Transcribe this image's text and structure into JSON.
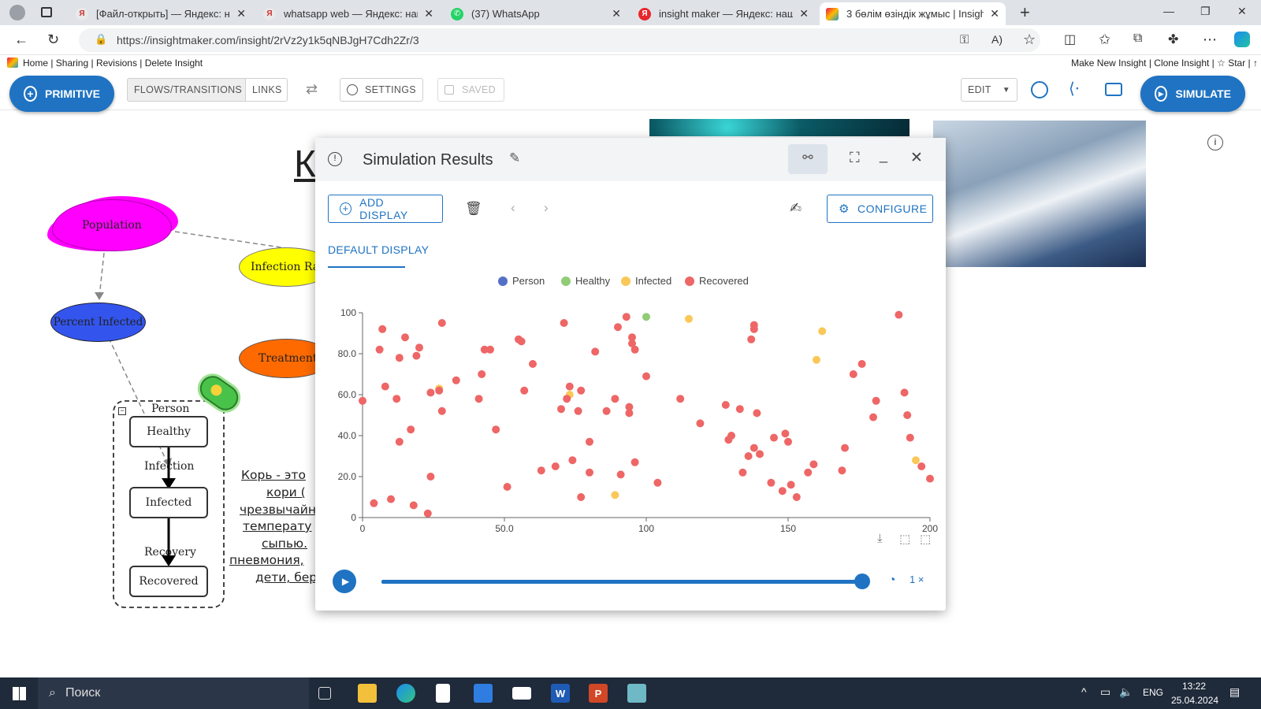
{
  "browser": {
    "tabs": [
      {
        "label": "[Файл-открыть] — Яндекс: нашл",
        "icon": "yandex-icon",
        "active": false
      },
      {
        "label": "whatsapp web — Яндекс: нашлс",
        "icon": "yandex-icon",
        "active": false
      },
      {
        "label": "(37) WhatsApp",
        "icon": "whatsapp-icon",
        "active": false
      },
      {
        "label": "insight maker — Яндекс: нашлос",
        "icon": "yandex-red-icon",
        "active": false
      },
      {
        "label": "3 бөлім өзіндік жұмыс | Insight",
        "icon": "insightmaker-icon",
        "active": true
      }
    ],
    "url": "https://insightmaker.com/insight/2rVz2y1k5qNBJgH7Cdh2Zr/3"
  },
  "insight_links": {
    "left": "Home | Sharing | Revisions | Delete Insight",
    "right": "Make New Insight | Clone Insight | ☆ Star | ↑"
  },
  "toolbar": {
    "primitive": "PRIMITIVE",
    "flows": "FLOWS/TRANSITIONS",
    "links": "LINKS",
    "settings": "SETTINGS",
    "saved": "SAVED",
    "edit": "EDIT",
    "simulate": "SIMULATE"
  },
  "diagram": {
    "title_fragment": "К",
    "population": "Population",
    "infection_rate": "Infection Ra",
    "percent_infected": "Percent Infected",
    "treatment": "Treatment",
    "agent_label": "Person",
    "states": [
      "Healthy",
      "Infected",
      "Recovered"
    ],
    "transitions": [
      "Infection",
      "Recovery"
    ],
    "description_lines": [
      "Корь - это",
      "кори (",
      "чрезвычайн",
      "температу",
      "сыпью.",
      "пневмония,",
      "дети, бер"
    ]
  },
  "sim": {
    "title": "Simulation Results",
    "add_display": "ADD DISPLAY",
    "configure": "CONFIGURE",
    "tab": "DEFAULT DISPLAY",
    "speed": "1 ×"
  },
  "chart_data": {
    "type": "scatter",
    "legend": [
      "Person",
      "Healthy",
      "Infected",
      "Recovered"
    ],
    "colors": {
      "Person": "#5470c6",
      "Healthy": "#91cc75",
      "Infected": "#fac858",
      "Recovered": "#ee6666"
    },
    "xlim": [
      0,
      200
    ],
    "ylim": [
      0,
      100
    ],
    "x_ticks": [
      "0",
      "50.0",
      "100",
      "150",
      "200"
    ],
    "y_ticks": [
      "0",
      "20.0",
      "40.0",
      "60.0",
      "80.0",
      "100"
    ],
    "series": [
      {
        "name": "Healthy",
        "points": [
          [
            100,
            98
          ]
        ]
      },
      {
        "name": "Infected",
        "points": [
          [
            27,
            63
          ],
          [
            73,
            60
          ],
          [
            89,
            11
          ],
          [
            115,
            97
          ],
          [
            160,
            77
          ],
          [
            162,
            91
          ],
          [
            195,
            28
          ]
        ]
      },
      {
        "name": "Recovered",
        "points": [
          [
            0,
            57
          ],
          [
            4,
            7
          ],
          [
            6,
            82
          ],
          [
            7,
            92
          ],
          [
            8,
            64
          ],
          [
            10,
            9
          ],
          [
            12,
            58
          ],
          [
            13,
            37
          ],
          [
            13,
            78
          ],
          [
            15,
            88
          ],
          [
            17,
            43
          ],
          [
            18,
            6
          ],
          [
            19,
            79
          ],
          [
            20,
            83
          ],
          [
            23,
            2
          ],
          [
            24,
            61
          ],
          [
            24,
            20
          ],
          [
            27,
            62
          ],
          [
            28,
            95
          ],
          [
            28,
            52
          ],
          [
            33,
            67
          ],
          [
            41,
            58
          ],
          [
            42,
            70
          ],
          [
            43,
            82
          ],
          [
            45,
            82
          ],
          [
            47,
            43
          ],
          [
            51,
            15
          ],
          [
            55,
            87
          ],
          [
            56,
            86
          ],
          [
            57,
            62
          ],
          [
            60,
            75
          ],
          [
            63,
            23
          ],
          [
            68,
            25
          ],
          [
            70,
            53
          ],
          [
            71,
            95
          ],
          [
            72,
            58
          ],
          [
            73,
            64
          ],
          [
            74,
            28
          ],
          [
            76,
            52
          ],
          [
            77,
            62
          ],
          [
            77,
            10
          ],
          [
            80,
            37
          ],
          [
            80,
            22
          ],
          [
            82,
            81
          ],
          [
            86,
            52
          ],
          [
            89,
            58
          ],
          [
            90,
            93
          ],
          [
            91,
            21
          ],
          [
            93,
            98
          ],
          [
            94,
            54
          ],
          [
            94,
            51
          ],
          [
            95,
            85
          ],
          [
            95,
            88
          ],
          [
            96,
            82
          ],
          [
            96,
            27
          ],
          [
            100,
            69
          ],
          [
            104,
            17
          ],
          [
            112,
            58
          ],
          [
            119,
            46
          ],
          [
            128,
            55
          ],
          [
            129,
            38
          ],
          [
            130,
            40
          ],
          [
            133,
            53
          ],
          [
            134,
            22
          ],
          [
            136,
            30
          ],
          [
            137,
            87
          ],
          [
            138,
            34
          ],
          [
            138,
            92
          ],
          [
            138,
            94
          ],
          [
            139,
            51
          ],
          [
            140,
            31
          ],
          [
            144,
            17
          ],
          [
            145,
            39
          ],
          [
            148,
            13
          ],
          [
            149,
            41
          ],
          [
            150,
            37
          ],
          [
            151,
            16
          ],
          [
            153,
            10
          ],
          [
            157,
            22
          ],
          [
            159,
            26
          ],
          [
            169,
            23
          ],
          [
            170,
            34
          ],
          [
            173,
            70
          ],
          [
            176,
            75
          ],
          [
            180,
            49
          ],
          [
            181,
            57
          ],
          [
            189,
            99
          ],
          [
            191,
            61
          ],
          [
            192,
            50
          ],
          [
            193,
            39
          ],
          [
            197,
            25
          ],
          [
            200,
            19
          ]
        ]
      }
    ]
  },
  "taskbar": {
    "search": "Поиск",
    "lang": "ENG",
    "time": "13:22",
    "date": "25.04.2024"
  }
}
